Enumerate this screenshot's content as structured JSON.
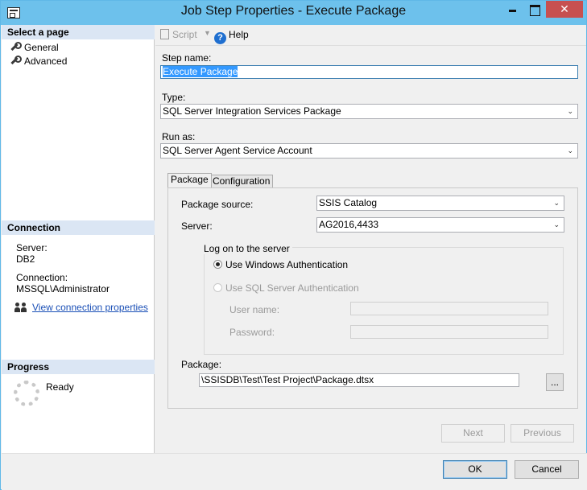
{
  "window": {
    "title": "Job Step Properties - Execute Package",
    "close_glyph": "✕"
  },
  "left": {
    "select_header": "Select a page",
    "pages": [
      {
        "label": "General"
      },
      {
        "label": "Advanced"
      }
    ],
    "connection_header": "Connection",
    "server_label": "Server:",
    "server_value": "DB2",
    "connection_label": "Connection:",
    "connection_value": "MSSQL\\Administrator",
    "view_link": "View connection properties",
    "progress_header": "Progress",
    "progress_status": "Ready"
  },
  "toolbar": {
    "script_label": "Script",
    "help_label": "Help"
  },
  "form": {
    "step_name_label": "Step name:",
    "step_name_value": "Execute Package",
    "type_label": "Type:",
    "type_value": "SQL Server Integration Services Package",
    "run_as_label": "Run as:",
    "run_as_value": "SQL Server Agent Service Account"
  },
  "tabs": [
    {
      "label": "Package"
    },
    {
      "label": "Configuration"
    }
  ],
  "package_tab": {
    "source_label": "Package source:",
    "source_value": "SSIS Catalog",
    "server_label": "Server:",
    "server_value": "AG2016,4433",
    "logon_group": "Log on to the server",
    "windows_auth": "Use Windows Authentication",
    "sql_auth": "Use SQL Server Authentication",
    "user_name_label": "User name:",
    "password_label": "Password:",
    "package_label": "Package:",
    "package_value": "\\SSISDB\\Test\\Test Project\\Package.dtsx",
    "browse_label": "..."
  },
  "nav": {
    "next": "Next",
    "previous": "Previous"
  },
  "footer": {
    "ok": "OK",
    "cancel": "Cancel"
  }
}
